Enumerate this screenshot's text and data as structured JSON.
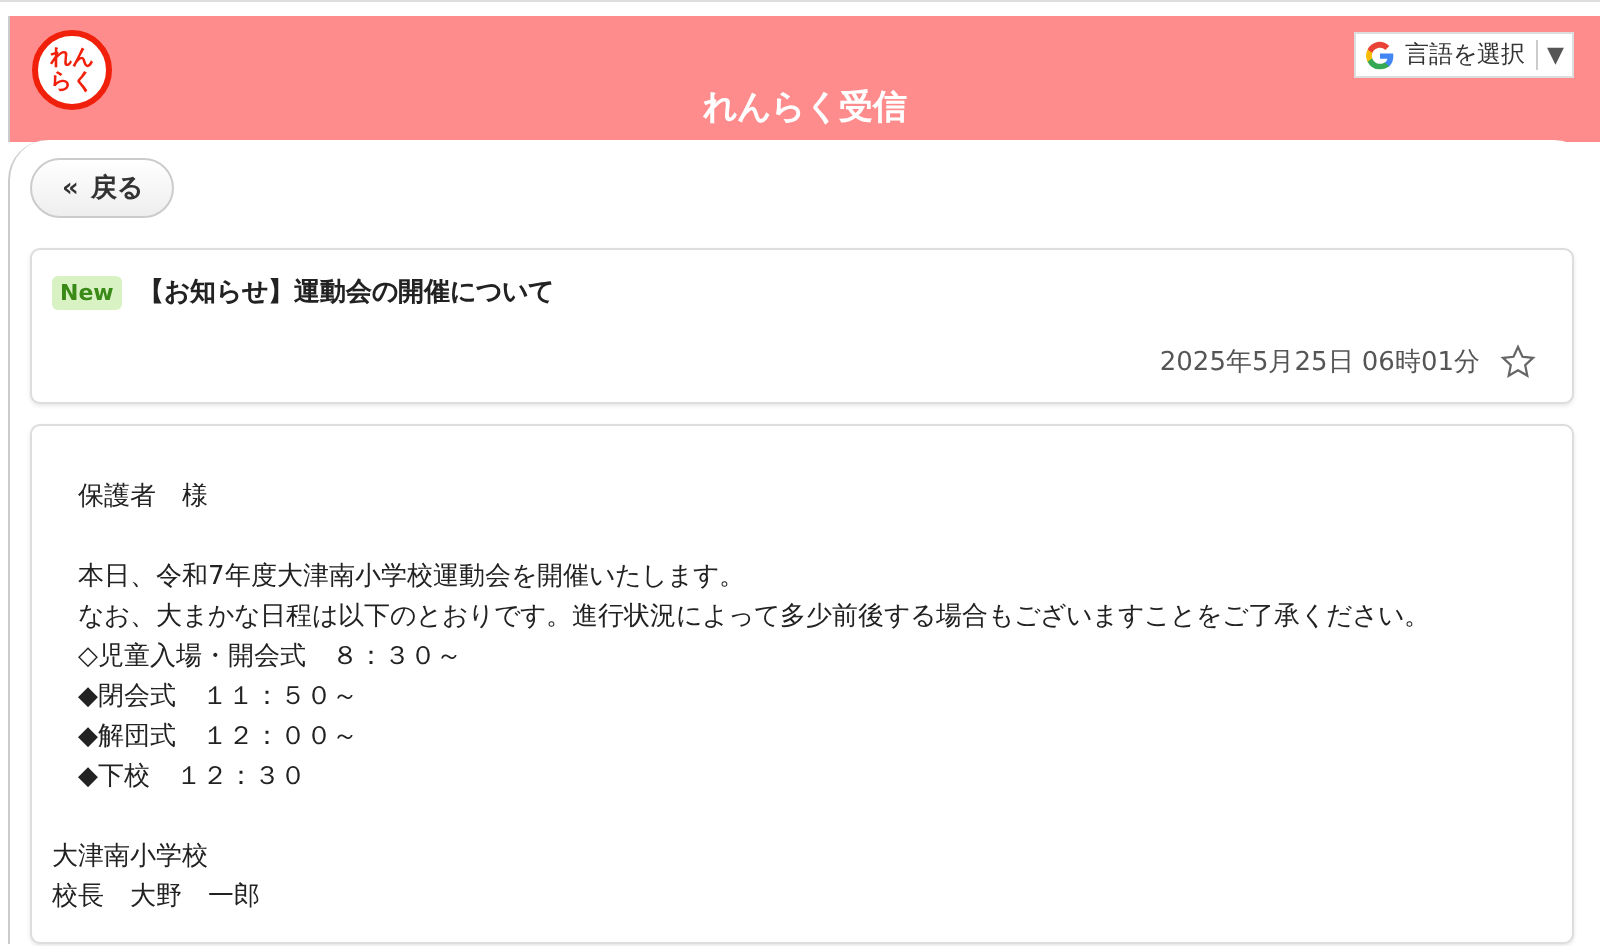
{
  "header": {
    "logo_lines": [
      "れん",
      "らく"
    ],
    "title": "れんらく受信",
    "language_select": {
      "label": "言語を選択",
      "caret": "▼"
    }
  },
  "back_button": {
    "icon": "«",
    "label": "戻る"
  },
  "message": {
    "badge": "New",
    "is_new": true,
    "subject": "【お知らせ】運動会の開催について",
    "datetime": "2025年5月25日 06時01分",
    "starred": false
  },
  "body": {
    "blocks": [
      [
        "保護者　様"
      ],
      [
        "本日、令和7年度大津南小学校運動会を開催いたします。",
        "なお、大まかな日程は以下のとおりです。進行状況によって多少前後する場合もございますことをご了承ください。",
        "◇児童入場・開会式　８：３０～",
        "◆閉会式　１１：５０～",
        "◆解団式　１２：００～",
        "◆下校　１２：３０"
      ]
    ],
    "signature": [
      "大津南小学校",
      "校長　大野　一郎"
    ]
  }
}
